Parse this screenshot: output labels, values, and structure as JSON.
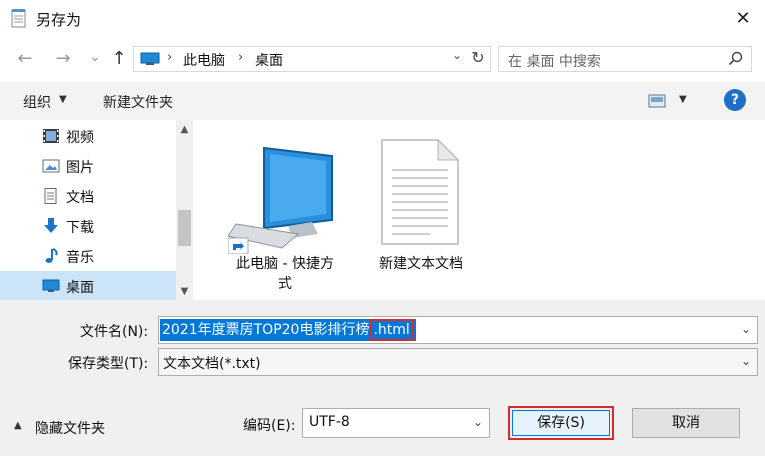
{
  "window": {
    "title": "另存为",
    "close_glyph": "✕"
  },
  "nav": {
    "back_glyph": "←",
    "forward_glyph": "→",
    "recent_glyph": "⌄",
    "up_glyph": "↑",
    "address": [
      "此电脑",
      "桌面"
    ],
    "address_sep": "›",
    "refresh_glyph": "↻",
    "search_placeholder": "在 桌面 中搜索"
  },
  "toolbar": {
    "organize_label": "组织",
    "new_folder_label": "新建文件夹",
    "help_glyph": "?"
  },
  "sidebar": {
    "items": [
      {
        "label": "视频",
        "icon": "video-icon"
      },
      {
        "label": "图片",
        "icon": "image-icon"
      },
      {
        "label": "文档",
        "icon": "document-icon"
      },
      {
        "label": "下载",
        "icon": "download-icon"
      },
      {
        "label": "音乐",
        "icon": "music-icon"
      },
      {
        "label": "桌面",
        "icon": "desktop-icon",
        "selected": true
      }
    ]
  },
  "files": [
    {
      "label_line1": "此电脑 - 快捷方",
      "label_line2": "式",
      "icon": "computer-shortcut-icon"
    },
    {
      "label_line1": "新建文本文档",
      "icon": "text-file-icon"
    }
  ],
  "form": {
    "filename_label": "文件名(N):",
    "filename_selected": "2021年度票房TOP20电影排行榜",
    "filename_ext": ".html",
    "filetype_label": "保存类型(T):",
    "filetype_value": "文本文档(*.txt)",
    "encoding_label": "编码(E):",
    "encoding_value": "UTF-8",
    "hide_folders_label": "隐藏文件夹",
    "save_label": "保存(S)",
    "cancel_label": "取消"
  },
  "colors": {
    "selection": "#0078d7",
    "highlight_box": "#d62b2b",
    "sidebar_selected": "#cce4f7"
  }
}
